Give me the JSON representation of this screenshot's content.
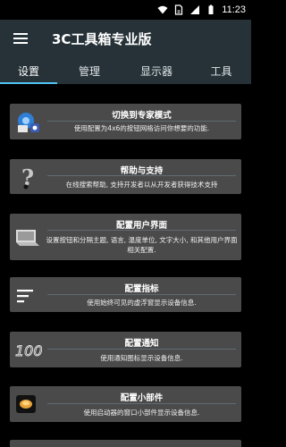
{
  "status": {
    "time": "11:23"
  },
  "app": {
    "title": "3C工具箱专业版"
  },
  "tabs": [
    {
      "label": "设置"
    },
    {
      "label": "管理"
    },
    {
      "label": "显示器"
    },
    {
      "label": "工具"
    }
  ],
  "cards": [
    {
      "title": "切换到专家模式",
      "desc": "使用配置为4x6的按钮网格访问你想要的功能.",
      "icon": "expert-mode-icon"
    },
    {
      "title": "帮助与支持",
      "desc": "在线搜索帮助, 支持开发者以从开发者获得技术支持",
      "icon": "help-icon"
    },
    {
      "title": "配置用户界面",
      "desc": "设置按钮和分隔主题, 语言, 温度单位, 文字大小, 和其他用户界面相关配置.",
      "icon": "ui-config-icon"
    },
    {
      "title": "配置指标",
      "desc": "使用始终可见的虚浮窗显示设备信息.",
      "icon": "indicator-icon"
    },
    {
      "title": "配置通知",
      "desc": "使用通知图标显示设备信息.",
      "icon": "notification-icon"
    },
    {
      "title": "配置小部件",
      "desc": "使用启动器的窗口小部件显示设备信息.",
      "icon": "widget-icon"
    }
  ],
  "colors": {
    "appbar": "#263238",
    "card": "#4a4a4a",
    "accent": "#4fc3f7"
  }
}
